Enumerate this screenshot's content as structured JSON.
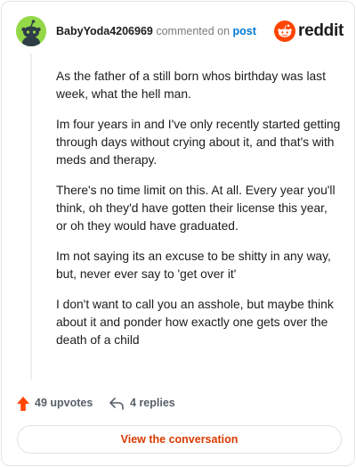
{
  "header": {
    "username": "BabyYoda4206969",
    "commented_on": "commented on",
    "post_link": "post",
    "brand": "reddit"
  },
  "comment": {
    "paragraphs": [
      "As the father of a still born whos birthday was last week, what the hell man.",
      "Im four years in and I've only recently started getting through days without crying about it, and that's with meds and therapy.",
      "There's no time limit on this. At all. Every year you'll think, oh they'd have gotten their license this year, or oh they would have graduated.",
      "Im not saying its an excuse to be shitty in any way, but, never ever say to 'get over it'",
      "I don't want to call you an asshole, but maybe think about it and ponder how exactly one gets over the death of a child"
    ]
  },
  "actions": {
    "upvotes": "49 upvotes",
    "replies": "4 replies"
  },
  "cta": {
    "label": "View the conversation"
  },
  "colors": {
    "accent_orange": "#ff4500",
    "link_blue": "#0079d3",
    "cta_text": "#d93a00",
    "avatar_green": "#94d849"
  },
  "icons": {
    "avatar": "snoo-avatar-icon",
    "brand": "reddit-logo-icon",
    "upvote": "upvote-arrow-icon",
    "reply": "reply-arrow-icon"
  }
}
